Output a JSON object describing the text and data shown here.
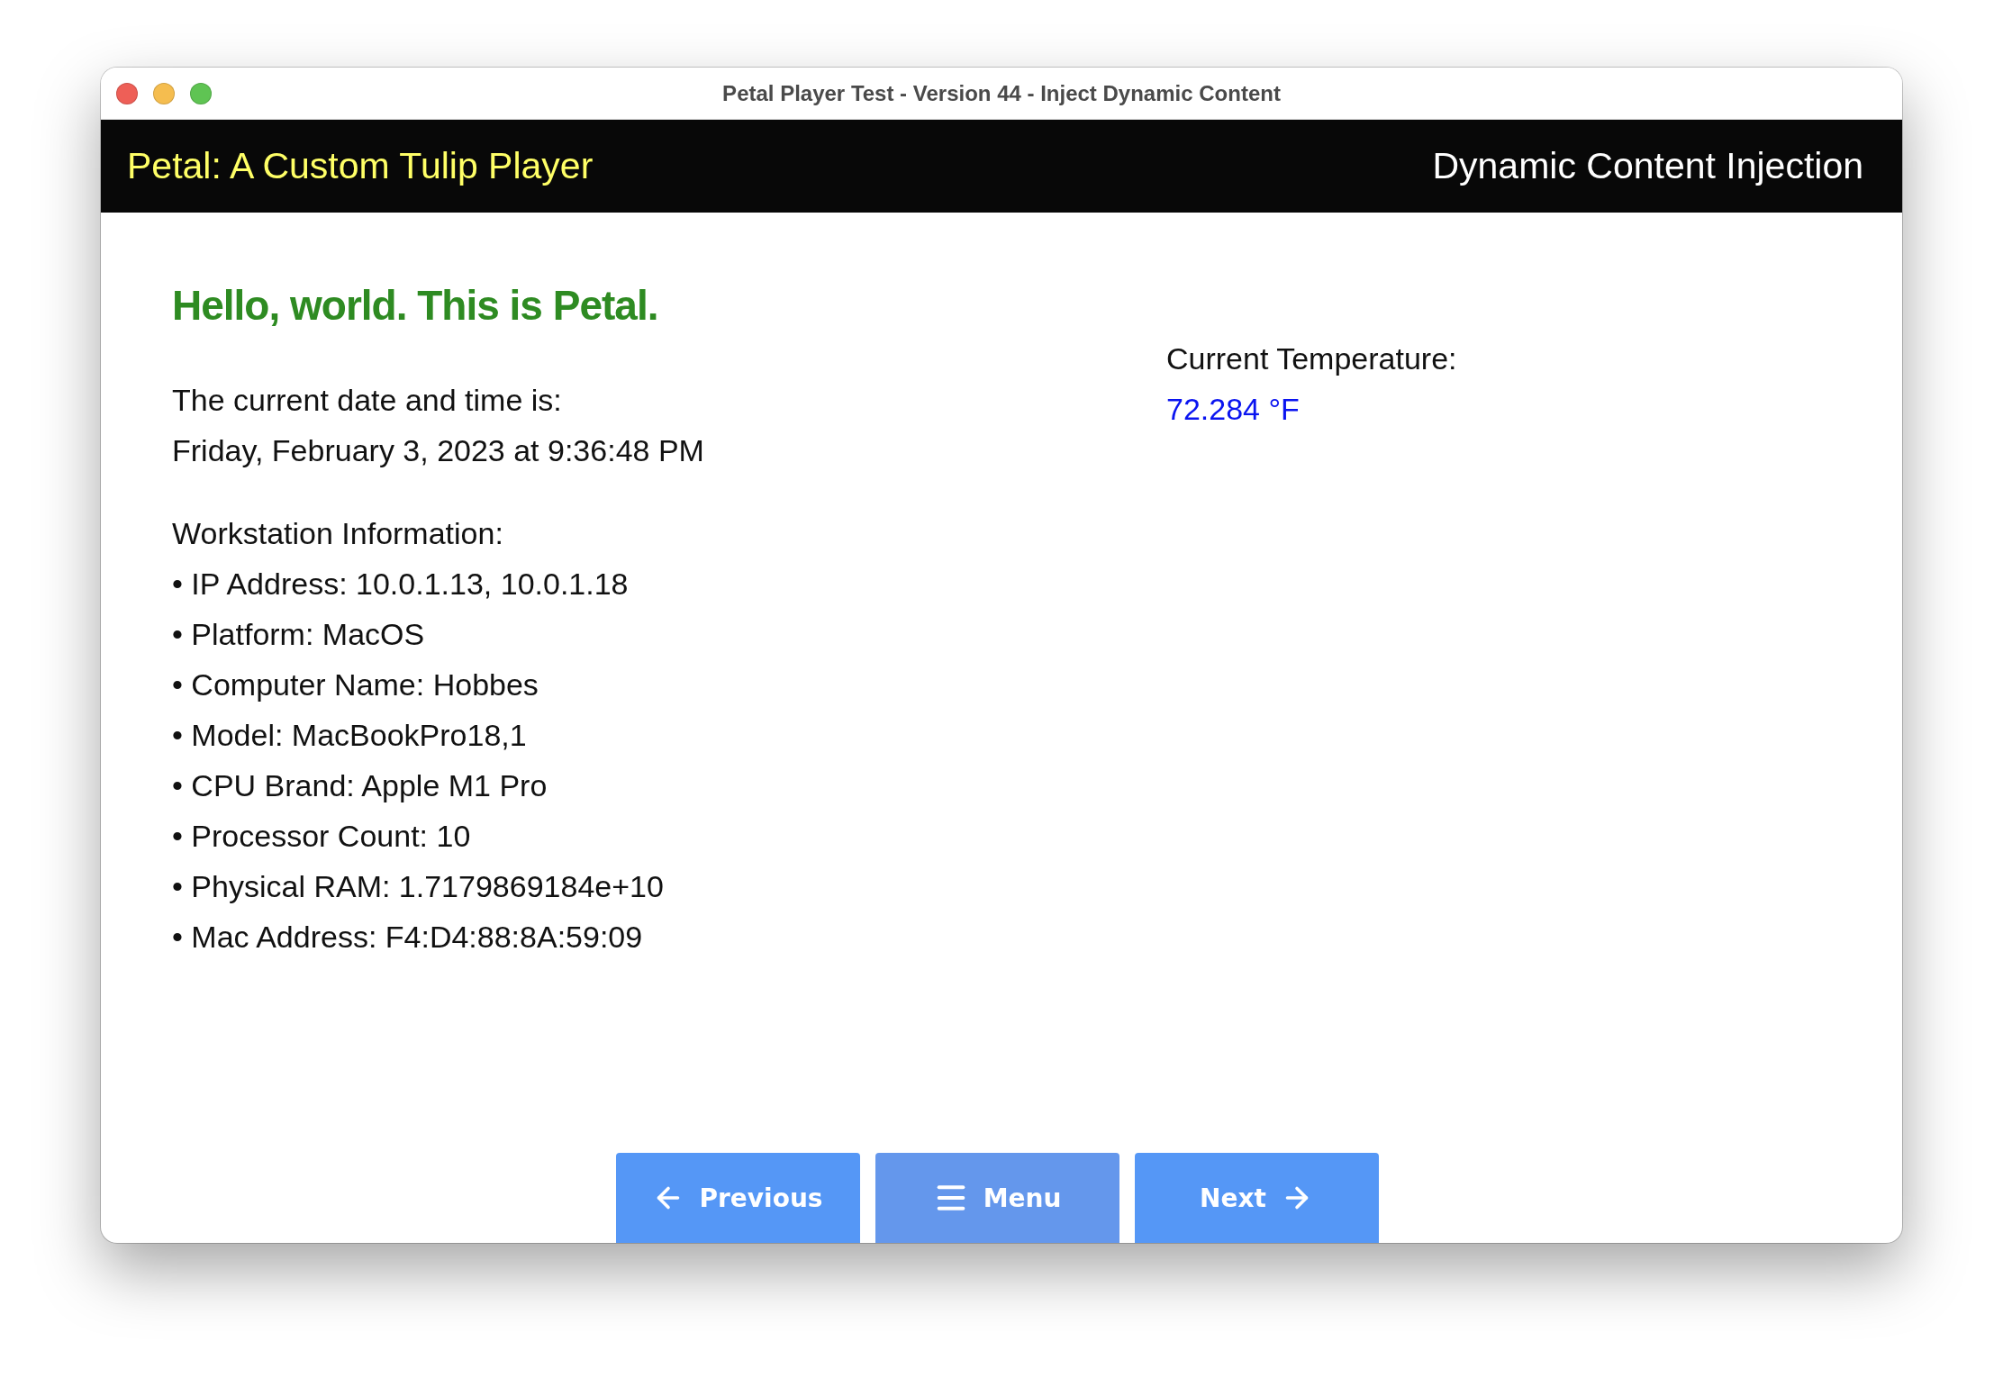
{
  "window": {
    "title": "Petal Player Test - Version 44 - Inject Dynamic Content"
  },
  "header": {
    "app_name": "Petal: A Custom Tulip Player",
    "page_title": "Dynamic Content Injection"
  },
  "heading": "Hello, world. This is Petal.",
  "datetime": {
    "label": "The current date and time is:",
    "value": "Friday, February 3, 2023 at 9:36:48 PM"
  },
  "workstation": {
    "title": "Workstation Information:",
    "items": [
      "• IP Address: 10.0.1.13, 10.0.1.18",
      "• Platform: MacOS",
      "• Computer Name: Hobbes",
      "• Model: MacBookPro18,1",
      "• CPU Brand: Apple M1 Pro",
      "• Processor Count: 10",
      "• Physical RAM: 1.7179869184e+10",
      "• Mac Address: F4:D4:88:8A:59:09"
    ]
  },
  "temperature": {
    "label": "Current Temperature:",
    "value": "72.284 °F"
  },
  "buttons": [
    {
      "kind": "previous",
      "label": "Previous",
      "highlighted": false
    },
    {
      "kind": "menu",
      "label": "Menu",
      "highlighted": true
    },
    {
      "kind": "next",
      "label": "Next",
      "highlighted": false
    }
  ]
}
